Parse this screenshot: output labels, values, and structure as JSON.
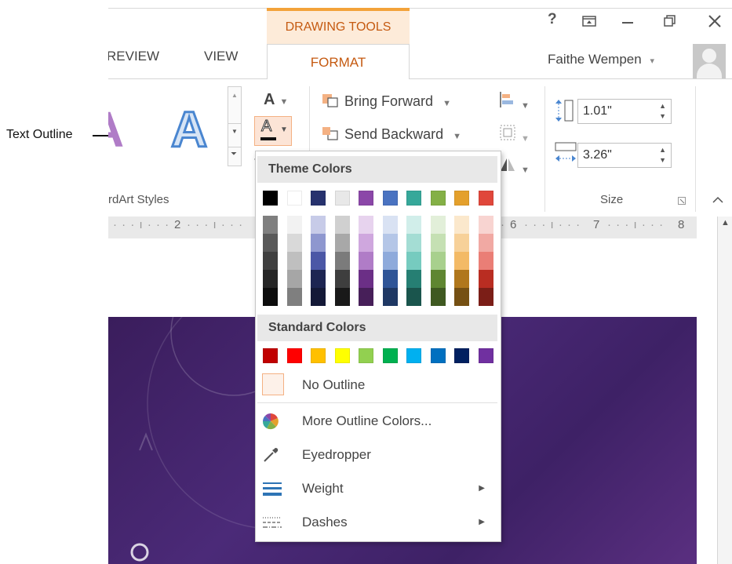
{
  "callout": {
    "label": "Text Outline"
  },
  "window": {
    "context_tab_group": "DRAWING TOOLS",
    "help_icon": "?",
    "user_name": "Faithe Wempen",
    "user_caret": "▾"
  },
  "tabs": {
    "review": "REVIEW",
    "view": "VIEW",
    "format": "FORMAT"
  },
  "ribbon": {
    "wordart_group_label": "rdArt Styles",
    "bring_forward": "Bring Forward",
    "send_backward": "Send Backward",
    "height_value": "1.01\"",
    "width_value": "3.26\"",
    "size_group_label": "Size",
    "text_fill_glyph": "A",
    "text_outline_glyph": "A"
  },
  "ruler": {
    "marks": [
      "2",
      "6",
      "7",
      "8"
    ]
  },
  "dropdown": {
    "theme_colors_header": "Theme Colors",
    "standard_colors_header": "Standard Colors",
    "theme_top_row": [
      "#000000",
      "#ffffff",
      "#27326e",
      "#e8e8e8",
      "#8b47a8",
      "#4a73c1",
      "#36a89a",
      "#84b046",
      "#e4a02c",
      "#e0473b"
    ],
    "theme_shades": [
      [
        "#7f7f7f",
        "#595959",
        "#404040",
        "#262626",
        "#0d0d0d"
      ],
      [
        "#f2f2f2",
        "#d9d9d9",
        "#bfbfbf",
        "#a6a6a6",
        "#7f7f7f"
      ],
      [
        "#c7cbe8",
        "#8e97cf",
        "#4b57a6",
        "#1d2552",
        "#141937"
      ],
      [
        "#d0d0d0",
        "#a8a8a8",
        "#7b7b7b",
        "#3e3e3e",
        "#191919"
      ],
      [
        "#e7d3ee",
        "#cfa7de",
        "#b07cc7",
        "#6b2f86",
        "#471f59"
      ],
      [
        "#d9e2f3",
        "#b4c6e7",
        "#8eaadb",
        "#2f5597",
        "#1f3864"
      ],
      [
        "#d1eeea",
        "#a4ddd4",
        "#76cbbf",
        "#267f73",
        "#1a554d"
      ],
      [
        "#e2efd9",
        "#c5e0b3",
        "#a8d08d",
        "#5f8631",
        "#3f5921"
      ],
      [
        "#fbe8cc",
        "#f7d199",
        "#f3ba66",
        "#b0771c",
        "#755013"
      ],
      [
        "#f8d4d1",
        "#f1a9a3",
        "#ea7e76",
        "#b92d22",
        "#7b1e17"
      ]
    ],
    "standard_colors": [
      "#c00000",
      "#ff0000",
      "#ffc000",
      "#ffff00",
      "#92d050",
      "#00b050",
      "#00b0f0",
      "#0070c0",
      "#002060",
      "#7030a0"
    ],
    "no_outline": "No Outline",
    "more_outline_colors": "More Outline Colors...",
    "eyedropper": "Eyedropper",
    "weight": "Weight",
    "dashes": "Dashes",
    "submenu_arrow": "▶"
  }
}
